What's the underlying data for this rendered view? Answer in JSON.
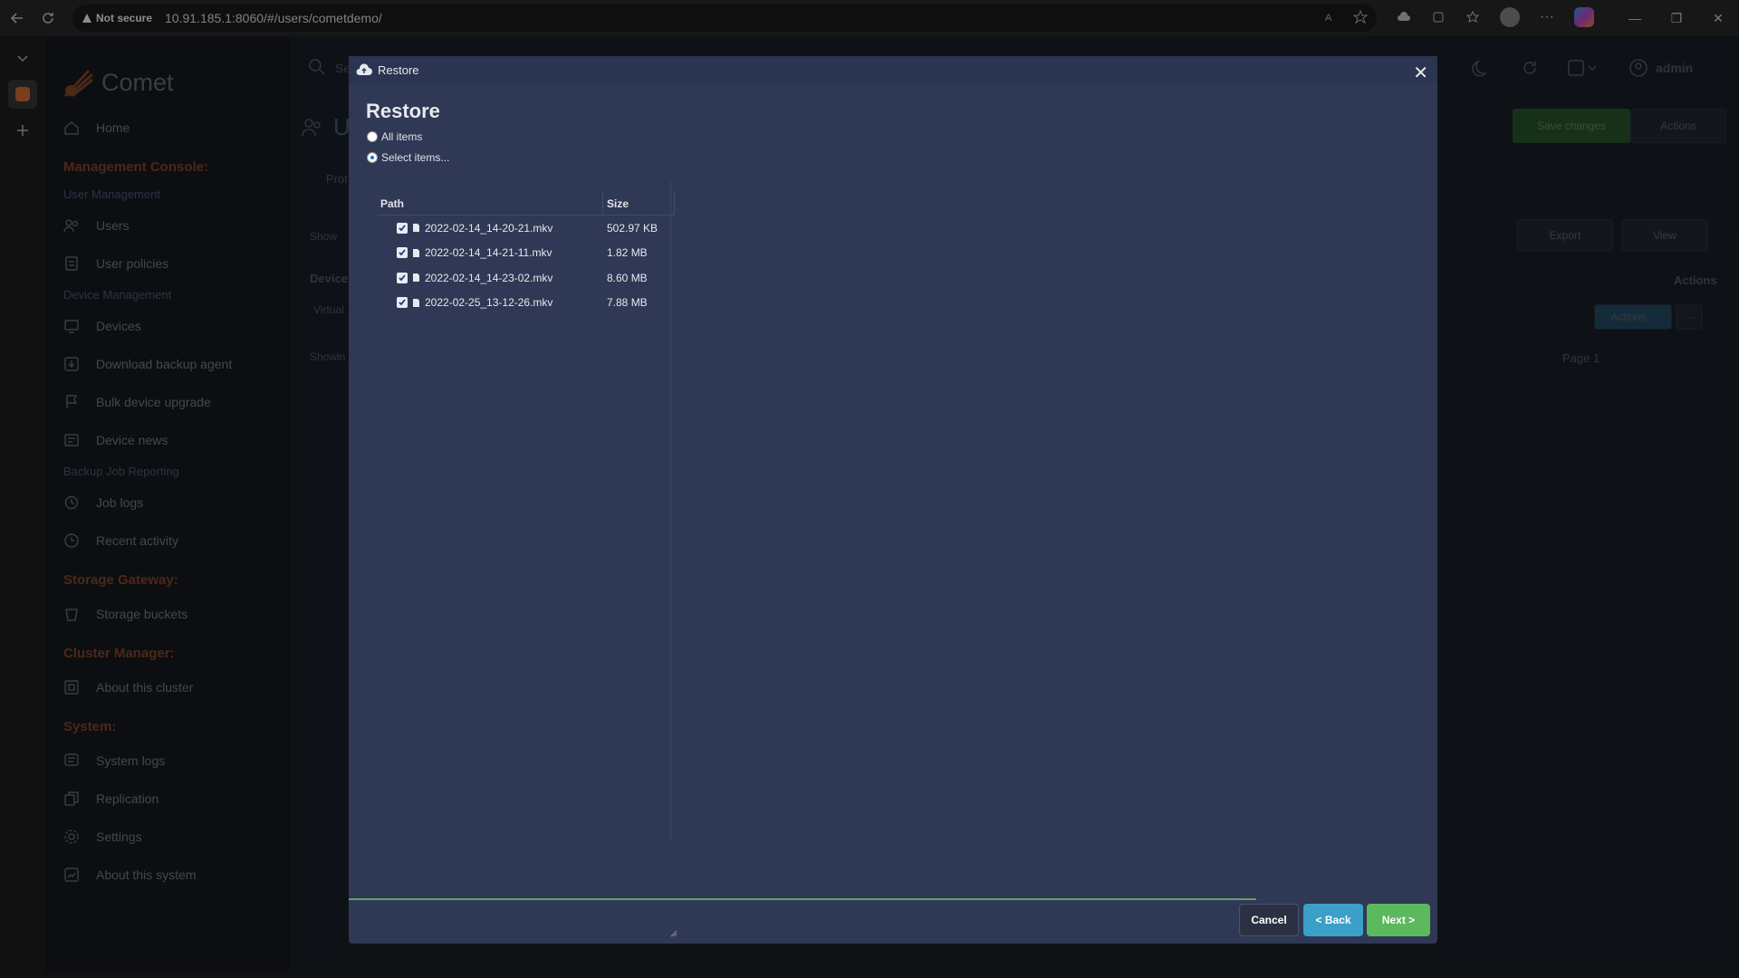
{
  "browser": {
    "security_label": "Not secure",
    "url": "10.91.185.1:8060/#/users/cometdemo/"
  },
  "app": {
    "brand": "Comet",
    "user_label": "admin"
  },
  "sidebar": {
    "home": "Home",
    "sections": [
      {
        "title": "Management Console:"
      },
      {
        "title": "Storage Gateway:"
      },
      {
        "title": "Cluster Manager:"
      },
      {
        "title": "System:"
      }
    ],
    "user_management": "User Management",
    "users": "Users",
    "user_policies": "User policies",
    "device_management": "Device Management",
    "devices": "Devices",
    "download_backup_agent": "Download backup agent",
    "bulk_device_upgrade": "Bulk device upgrade",
    "device_news": "Device news",
    "backup_job_reporting": "Backup Job Reporting",
    "job_logs": "Job logs",
    "recent_activity": "Recent activity",
    "storage_buckets": "Storage buckets",
    "about_cluster": "About this cluster",
    "system_logs": "System logs",
    "replication": "Replication",
    "settings": "Settings",
    "about_system": "About this system"
  },
  "background": {
    "search_placeholder": "Se",
    "page_heading": "U",
    "tab_profile": "Prot",
    "show_label": "Show",
    "devices_label": "Device",
    "virtual_label": "Virtual",
    "showing_label": "Showin",
    "save_changes": "Save changes",
    "actions": "Actions",
    "export": "Export",
    "view": "View",
    "actions_col": "Actions",
    "row_actions": "Actions...",
    "page_label": "Page 1"
  },
  "modal": {
    "header": "Restore",
    "title": "Restore",
    "option_all": "All items",
    "option_select": "Select items...",
    "table": {
      "col_path": "Path",
      "col_size": "Size",
      "rows": [
        {
          "path": "2022-02-14_14-20-21.mkv",
          "size": "502.97 KB"
        },
        {
          "path": "2022-02-14_14-21-11.mkv",
          "size": "1.82 MB"
        },
        {
          "path": "2022-02-14_14-23-02.mkv",
          "size": "8.60 MB"
        },
        {
          "path": "2022-02-25_13-12-26.mkv",
          "size": "7.88 MB"
        }
      ]
    },
    "cancel": "Cancel",
    "back": "< Back",
    "next": "Next >"
  },
  "colors": {
    "modal_bg": "#2f3854",
    "next_button": "#5cb85c",
    "back_button": "#3aa0c8",
    "section_title": "#8a4a2b"
  }
}
